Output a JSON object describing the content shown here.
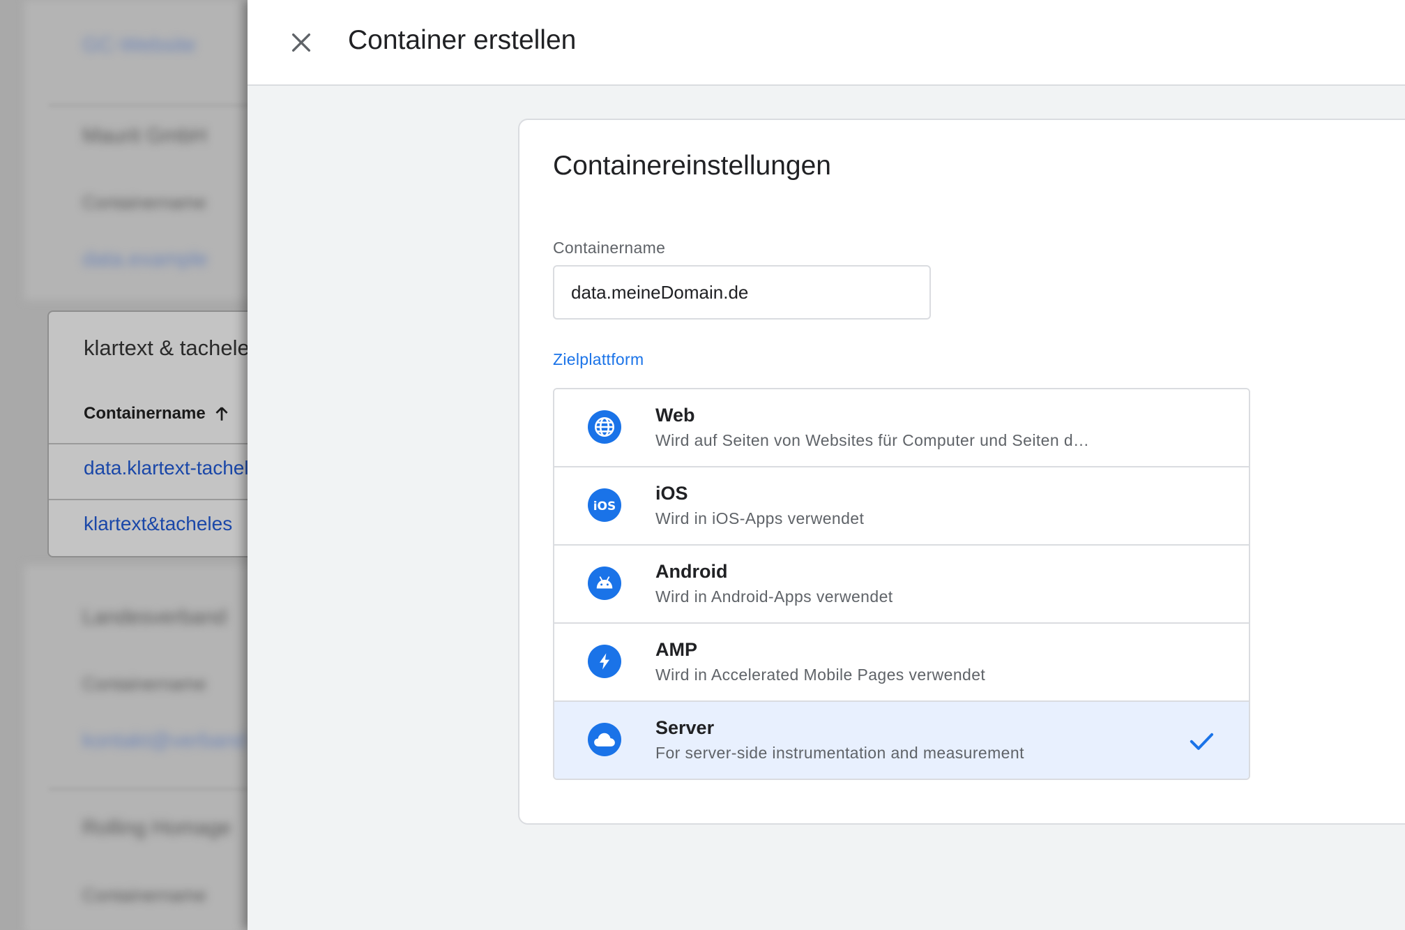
{
  "background": {
    "card_title": "klartext & tacheles",
    "column_header": "Containername",
    "rows": [
      "data.klartext-tacheles.de",
      "klartext&tacheles"
    ]
  },
  "dialog": {
    "title": "Container erstellen",
    "close_icon": "close-icon"
  },
  "settings": {
    "title": "Containereinstellungen",
    "name_label": "Containername",
    "name_value": "data.meineDomain.de",
    "platform_label": "Zielplattform",
    "platforms": [
      {
        "title": "Web",
        "description": "Wird auf Seiten von Websites für Computer und Seiten d…",
        "icon": "globe-icon",
        "selected": false
      },
      {
        "title": "iOS",
        "description": "Wird in iOS-Apps verwendet",
        "icon": "ios-icon",
        "selected": false
      },
      {
        "title": "Android",
        "description": "Wird in Android-Apps verwendet",
        "icon": "android-icon",
        "selected": false
      },
      {
        "title": "AMP",
        "description": "Wird in Accelerated Mobile Pages verwendet",
        "icon": "lightning-icon",
        "selected": false
      },
      {
        "title": "Server",
        "description": "For server-side instrumentation and measurement",
        "icon": "cloud-icon",
        "selected": true
      }
    ]
  },
  "colors": {
    "accent": "#1a73e8",
    "selected_bg": "#e8f0fe",
    "link": "#1a47a8"
  }
}
